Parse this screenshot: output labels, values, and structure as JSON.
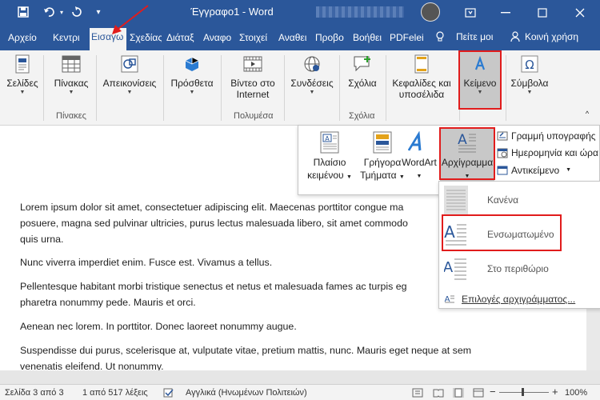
{
  "titlebar": {
    "title": "Έγγραφο1 - Word",
    "icons": [
      "save-icon",
      "undo-icon",
      "redo-icon",
      "customize-qat-icon"
    ]
  },
  "tabs": [
    {
      "label": "Αρχείο"
    },
    {
      "label": "Κεντρι"
    },
    {
      "label": "Εισαγω"
    },
    {
      "label": "Σχεδίας"
    },
    {
      "label": "Διάταξ"
    },
    {
      "label": "Αναφο"
    },
    {
      "label": "Στοιχεί"
    },
    {
      "label": "Αναθει"
    },
    {
      "label": "Προβο"
    },
    {
      "label": "Βοήθει"
    },
    {
      "label": "PDFelei"
    }
  ],
  "tell_me": "Πείτε μοι",
  "share": "Κοινή χρήση",
  "ribbon": {
    "pages": "Σελίδες",
    "table": "Πίνακας",
    "tables_group": "Πίνακες",
    "illustrations": "Απεικονίσεις",
    "addins": "Πρόσθετα",
    "video_line1": "Βίντεο στο",
    "video_line2": "Internet",
    "media_group": "Πολυμέσα",
    "links": "Συνδέσεις",
    "comments": "Σχόλια",
    "comments_group": "Σχόλια",
    "header_line1": "Κεφαλίδες και",
    "header_line2": "υποσέλιδα",
    "text": "Κείμενο",
    "symbols": "Σύμβολα"
  },
  "text_panel": {
    "textbox_line1": "Πλαίσιο",
    "textbox_line2": "κειμένου",
    "quickparts_line1": "Γρήγορα",
    "quickparts_line2": "Τμήματα",
    "wordart": "WordArt",
    "dropcap": "Αρχίγραμμα",
    "signature_line": "Γραμμή υπογραφής",
    "date_time": "Ημερομηνία και ώρα",
    "object": "Αντικείμενο"
  },
  "dropcap_menu": {
    "none": "Κανένα",
    "dropped": "Ενσωματωμένο",
    "in_margin": "Στο περιθώριο",
    "options": "Επιλογές αρχιγράμματος..."
  },
  "document": {
    "paragraphs": [
      "Lorem ipsum dolor sit amet, consectetuer adipiscing elit. Maecenas porttitor congue ma",
      "posuere, magna sed pulvinar ultricies, purus lectus malesuada libero, sit amet commodo",
      "quis urna.",
      "Nunc viverra imperdiet enim. Fusce est. Vivamus a tellus.",
      "Pellentesque habitant morbi tristique senectus et netus et malesuada fames ac turpis eg",
      "pharetra nonummy pede. Mauris et orci.",
      "Aenean nec lorem. In porttitor. Donec laoreet nonummy augue.",
      "Suspendisse dui purus, scelerisque at, vulputate vitae, pretium mattis, nunc. Mauris eget neque at sem",
      "venenatis eleifend. Ut nonummy."
    ]
  },
  "status": {
    "page": "Σελίδα 3 από 3",
    "words": "1 από 517 λέξεις",
    "language": "Αγγλικά (Ηνωμένων Πολιτειών)",
    "zoom": "100%",
    "minus": "−",
    "plus": "+"
  },
  "colors": {
    "brand": "#2b579a",
    "highlight": "#e11c1c",
    "ribbon": "#f3f3f3"
  }
}
